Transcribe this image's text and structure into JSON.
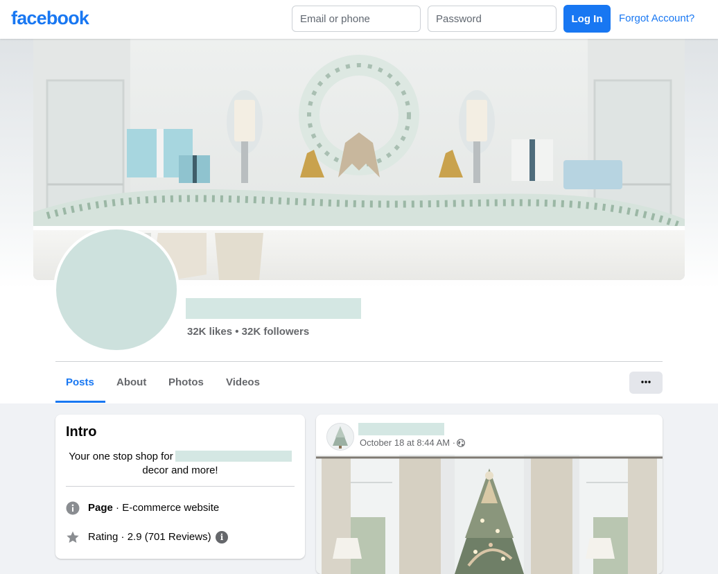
{
  "topbar": {
    "logo": "facebook",
    "email_placeholder": "Email or phone",
    "password_placeholder": "Password",
    "login_label": "Log In",
    "forgot_label": "Forgot Account?"
  },
  "profile": {
    "stats": "32K likes • 32K followers"
  },
  "tabs": [
    "Posts",
    "About",
    "Photos",
    "Videos"
  ],
  "intro": {
    "title": "Intro",
    "bio_prefix": "Your one stop shop for",
    "bio_suffix": "decor and more!",
    "page_label": "Page",
    "page_category": " · E-commerce website",
    "rating_text": "Rating · 2.9 (701 Reviews)",
    "info_glyph": "i"
  },
  "post": {
    "timestamp": "October 18 at 8:44 AM",
    "separator": " · "
  },
  "icons": {
    "more": "more-horizontal-icon",
    "page_info": "info-icon",
    "rating": "star-icon",
    "audience": "globe-icon"
  },
  "colors": {
    "brand": "#1877f2",
    "redaction": "#d4e7e3",
    "muted_text": "#65676b"
  }
}
